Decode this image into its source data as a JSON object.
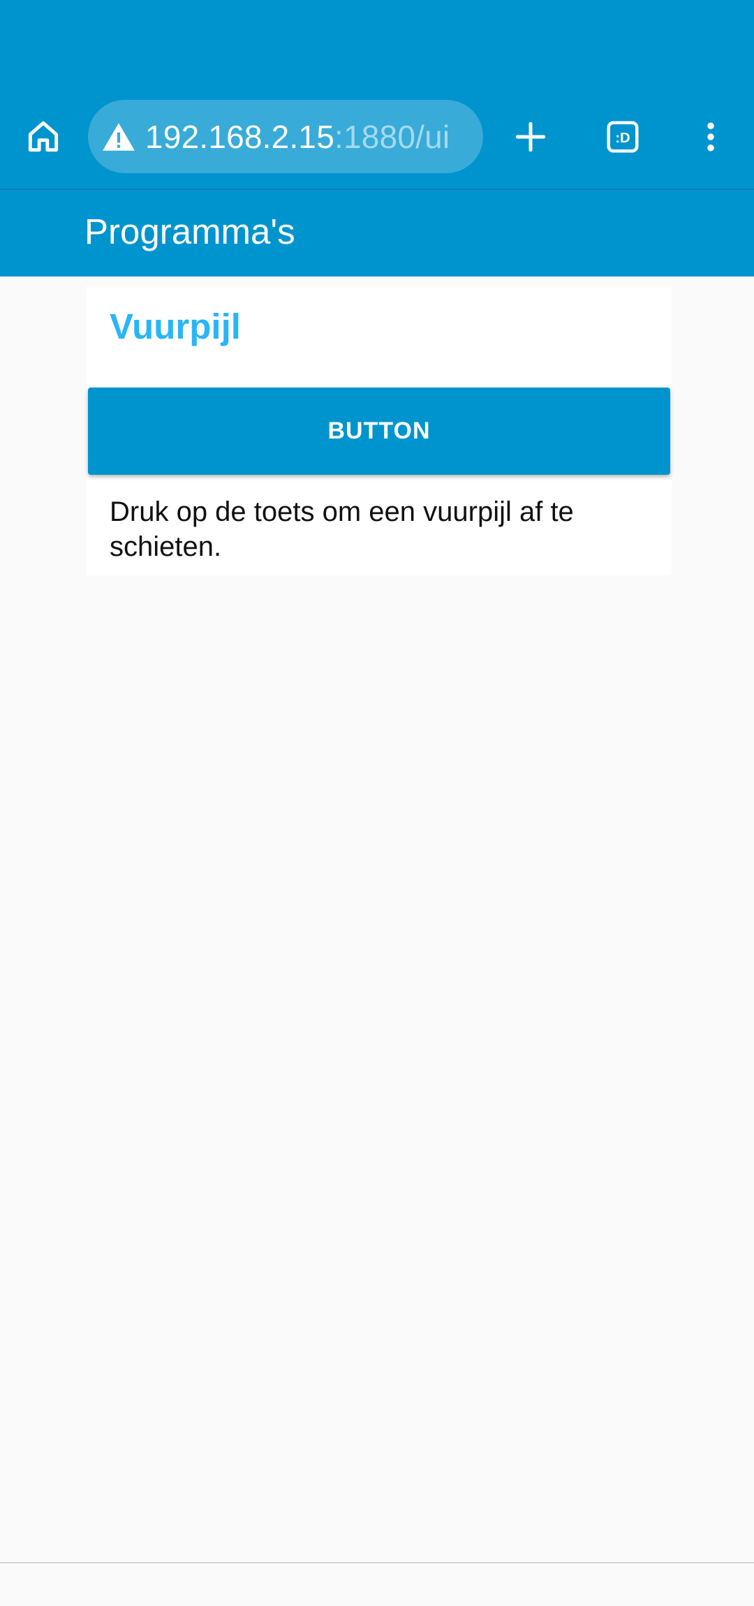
{
  "browser": {
    "url_host": "192.168.2.15",
    "url_rest": ":1880/ui",
    "icons": {
      "home": "home-icon",
      "warning": "warning-icon",
      "new_tab": "plus-icon",
      "tabs": "tab-switcher-icon",
      "tabs_label": ":D",
      "menu": "kebab-menu-icon"
    }
  },
  "app": {
    "title": "Programma's"
  },
  "card": {
    "title": "Vuurpijl",
    "button_label": "BUTTON",
    "description": "Druk op de toets om een vuurpijl af te schieten."
  },
  "colors": {
    "primary": "#0094ce",
    "accent": "#29b6f6",
    "background": "#fafafa",
    "card": "#ffffff"
  }
}
